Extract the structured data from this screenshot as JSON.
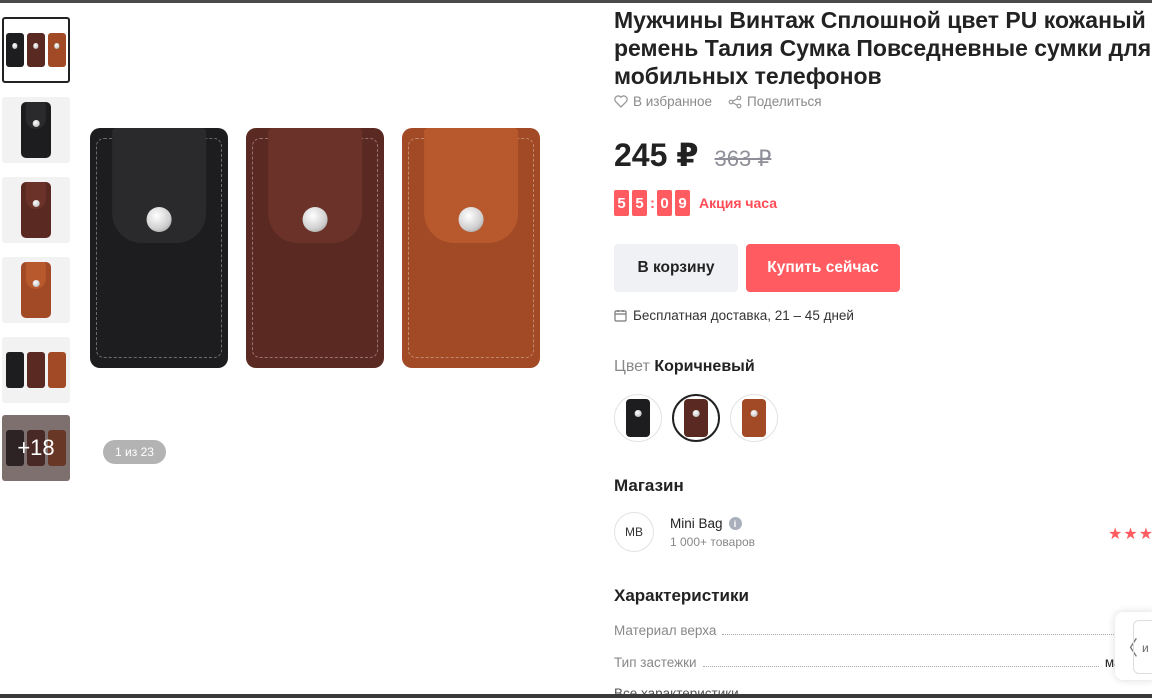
{
  "gallery": {
    "thumbnails": [
      {
        "kind": "trio"
      },
      {
        "kind": "black"
      },
      {
        "kind": "dark-brown"
      },
      {
        "kind": "brown"
      },
      {
        "kind": "trio-labels"
      },
      {
        "kind": "model",
        "more": "+18"
      }
    ],
    "counter": "1 из 23"
  },
  "product": {
    "title_lines": [
      "Мужчины Винтаж Сплошной цвет PU кожаный",
      "ремень Талия Сумка Повседневные сумки для",
      "мобильных телефонов"
    ],
    "favorite_label": "В избранное",
    "share_label": "Поделиться",
    "price_current": "245 ₽",
    "price_old": "363 ₽",
    "timer_digits": [
      "5",
      "5",
      "0",
      "9"
    ],
    "timer_sep": ":",
    "promo_label": "Акция часа",
    "add_to_cart_label": "В корзину",
    "buy_now_label": "Купить сейчас",
    "delivery_text": "Бесплатная доставка, 21 – 45 дней",
    "color_key": "Цвет",
    "color_value": "Коричневый",
    "colors": [
      {
        "name": "black",
        "hex": "#1d1d1f"
      },
      {
        "name": "dark-brown",
        "hex": "#5a2a22"
      },
      {
        "name": "brown",
        "hex": "#a14a25"
      }
    ],
    "selected_color_index": 1
  },
  "shop": {
    "section_title": "Магазин",
    "avatar_text": "MB",
    "name": "Mini Bag",
    "info_icon": "i",
    "product_count": "1 000+ товаров",
    "stars": "★★★"
  },
  "specs": {
    "section_title": "Характеристики",
    "rows": [
      {
        "key": "Материал верха",
        "value": ""
      },
      {
        "key": "Тип застежки",
        "value": "магн"
      }
    ],
    "all_specs_label": "Все характеристики"
  },
  "side_widget": {
    "arrow": "〈",
    "text": "и"
  },
  "icons": {
    "heart": "heart-icon",
    "share": "share-icon",
    "calendar": "calendar-icon",
    "info": "info-icon"
  },
  "colors": {
    "accent": "#ff5b60",
    "muted_text": "#888888",
    "cart_button_bg": "#f0f1f5"
  }
}
